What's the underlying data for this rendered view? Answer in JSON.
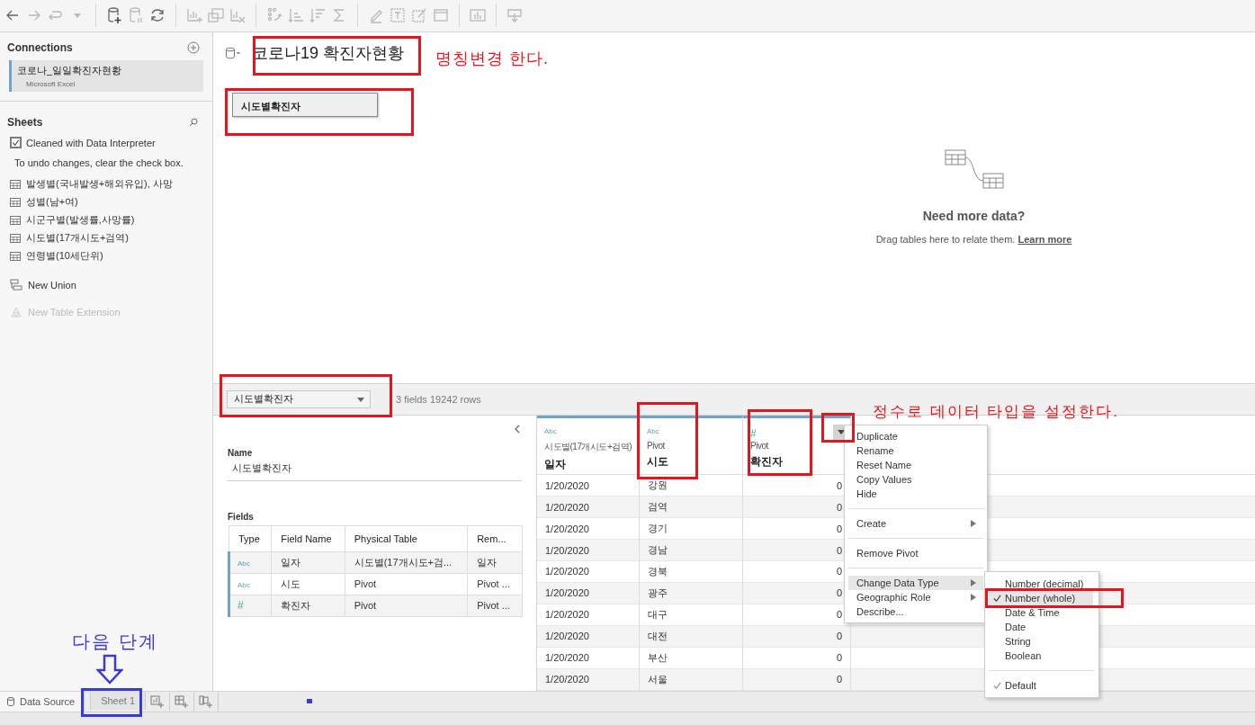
{
  "connections": {
    "title": "Connections",
    "items": [
      {
        "name": "코로나_일일확진자현황",
        "type": "Microsoft Excel",
        "selected": true
      }
    ]
  },
  "sheets": {
    "title": "Sheets",
    "interpreter": {
      "label": "Cleaned with Data Interpreter",
      "checked": true
    },
    "note": "To undo changes, clear the check box.",
    "items": [
      "발생별(국내발생+해외유입), 사망",
      "성별(남+여)",
      "시군구별(발생률,사망률)",
      "시도별(17개시도+검역)",
      "연령별(10세단위)"
    ],
    "actions": [
      {
        "label": "New Union",
        "disabled": false
      },
      {
        "label": "New Table Extension",
        "disabled": true
      }
    ]
  },
  "data_source": {
    "title": "코로나19 확진자현황",
    "tables": [
      "시도별확진자"
    ],
    "hint": {
      "title": "Need more data?",
      "text": "Drag tables here to relate them.",
      "link": "Learn more"
    }
  },
  "band": {
    "selector": "시도별확진자",
    "summary": "3 fields 19242 rows"
  },
  "details": {
    "name_label": "Name",
    "name": "시도별확진자",
    "fields_label": "Fields",
    "columns": [
      "Type",
      "Field Name",
      "Physical Table",
      "Rem..."
    ],
    "rows": [
      {
        "type": "Abc",
        "kind": "string",
        "name": "일자",
        "table": "시도별(17개시도+검...",
        "remote": "일자"
      },
      {
        "type": "Abc",
        "kind": "string",
        "name": "시도",
        "table": "Pivot",
        "remote": "Pivot ..."
      },
      {
        "type": "#",
        "kind": "number",
        "name": "확진자",
        "table": "Pivot",
        "remote": "Pivot ..."
      }
    ]
  },
  "grid": {
    "columns": [
      {
        "type": "Abc",
        "kind": "string",
        "source": "시도별(17개시도+검역)",
        "name": "일자"
      },
      {
        "type": "Abc",
        "kind": "string",
        "source": "Pivot",
        "name": "시도"
      },
      {
        "type": "#",
        "kind": "number",
        "source": "Pivot",
        "name": "확진자"
      }
    ],
    "rows": [
      [
        "1/20/2020",
        "강원",
        "0"
      ],
      [
        "1/20/2020",
        "검역",
        "0"
      ],
      [
        "1/20/2020",
        "경기",
        "0"
      ],
      [
        "1/20/2020",
        "경남",
        "0"
      ],
      [
        "1/20/2020",
        "경북",
        "0"
      ],
      [
        "1/20/2020",
        "광주",
        "0"
      ],
      [
        "1/20/2020",
        "대구",
        "0"
      ],
      [
        "1/20/2020",
        "대전",
        "0"
      ],
      [
        "1/20/2020",
        "부산",
        "0"
      ],
      [
        "1/20/2020",
        "서울",
        "0"
      ]
    ]
  },
  "context_menu": {
    "groups": [
      [
        {
          "label": "Duplicate",
          "submenu": false,
          "selected": false
        },
        {
          "label": "Rename",
          "submenu": false,
          "selected": false
        },
        {
          "label": "Reset Name",
          "submenu": false,
          "selected": false
        },
        {
          "label": "Copy Values",
          "submenu": false,
          "selected": false
        },
        {
          "label": "Hide",
          "submenu": false,
          "selected": false
        }
      ],
      [
        {
          "label": "Create",
          "submenu": true,
          "selected": false
        }
      ],
      [
        {
          "label": "Remove Pivot",
          "submenu": false,
          "selected": false
        }
      ],
      [
        {
          "label": "Change Data Type",
          "submenu": true,
          "selected": true
        },
        {
          "label": "Geographic Role",
          "submenu": true,
          "selected": false
        },
        {
          "label": "Describe...",
          "submenu": false,
          "selected": false
        }
      ]
    ]
  },
  "submenu": {
    "items": [
      {
        "label": "Number (decimal)",
        "checked": false,
        "selected": false
      },
      {
        "label": "Number (whole)",
        "checked": true,
        "selected": true
      },
      {
        "label": "Date & Time",
        "checked": false,
        "selected": false
      },
      {
        "label": "Date",
        "checked": false,
        "selected": false
      },
      {
        "label": "String",
        "checked": false,
        "selected": false
      },
      {
        "label": "Boolean",
        "checked": false,
        "selected": false
      }
    ],
    "default": {
      "label": "Default",
      "checked": true
    }
  },
  "tabs": [
    {
      "label": "Data Source",
      "selected": true
    },
    {
      "label": "Sheet 1",
      "selected": false
    }
  ],
  "annotations": [
    {
      "text": "명칭변경 한다.",
      "color": "#e8141c"
    },
    {
      "text": "정수로 데이터 타입을 설정한다.",
      "color": "#e8141c"
    },
    {
      "text": "다음 단계",
      "color": "#3a3ad6"
    }
  ]
}
